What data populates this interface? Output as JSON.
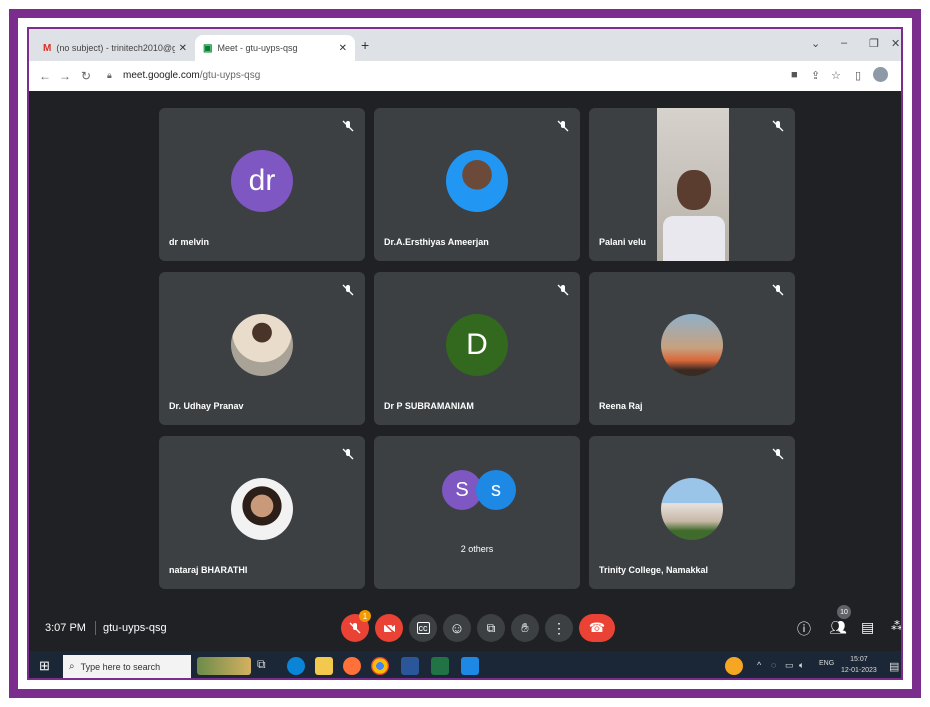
{
  "browser": {
    "tabs": [
      {
        "title": "(no subject) - trinitech2010@gm",
        "icon": "gmail-icon"
      },
      {
        "title": "Meet - gtu-uyps-qsg",
        "icon": "meet-icon"
      }
    ],
    "url_host": "meet.google.com",
    "url_path": "/gtu-uyps-qsg"
  },
  "participants": [
    {
      "name": "dr melvin",
      "initial": "dr",
      "color": "#7e57c2"
    },
    {
      "name": "Dr.A.Ersthiyas Ameerjan"
    },
    {
      "name": "Palani velu"
    },
    {
      "name": "Dr. Udhay Pranav"
    },
    {
      "name": "Dr P SUBRAMANIAM",
      "initial": "D",
      "color": "#33691e"
    },
    {
      "name": "Reena Raj"
    },
    {
      "name": "nataraj BHARATHI"
    },
    {
      "name": "2 others",
      "initials": [
        "S",
        "s"
      ],
      "colors": [
        "#7e57c2",
        "#1e88e5"
      ]
    },
    {
      "name": "Trinity College, Namakkal"
    }
  ],
  "meeting": {
    "time": "3:07 PM",
    "code": "gtu-uyps-qsg",
    "participant_count": "10",
    "mic_badge": "1"
  },
  "taskbar": {
    "search_placeholder": "Type here to search",
    "lang": "ENG",
    "time": "15:07",
    "date": "12-01-2023"
  },
  "colors": {
    "frame": "#7b2d8e",
    "meet_bg": "#202124",
    "tile_bg": "#3c4043",
    "end_call": "#ea4335"
  }
}
